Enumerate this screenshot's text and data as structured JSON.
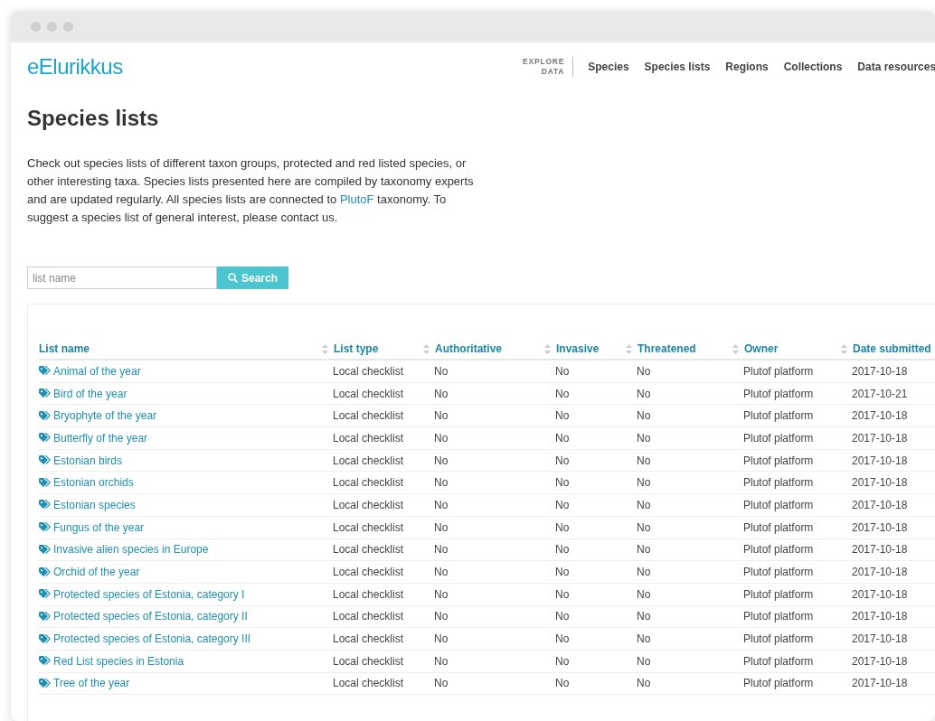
{
  "site": {
    "logo": "eElurikkus",
    "nav_caption": [
      "EXPLORE",
      "DATA"
    ],
    "nav": [
      "Species",
      "Species lists",
      "Regions",
      "Collections",
      "Data resources"
    ]
  },
  "page": {
    "title": "Species lists",
    "intro_before_link": "Check out species lists of different taxon groups, protected and red listed species, or other interesting taxa. Species lists presented here are compiled by taxonomy experts and are updated regularly. All species lists are connected to ",
    "intro_link": "PlutoF",
    "intro_after_link": " taxonomy. To suggest a species list of general interest, please contact us."
  },
  "search": {
    "placeholder": "list name",
    "button": "Search"
  },
  "table": {
    "columns": [
      "List name",
      "List type",
      "Authoritative",
      "Invasive",
      "Threatened",
      "Owner",
      "Date submitted"
    ],
    "rows": [
      [
        "Animal of the year",
        "Local checklist",
        "No",
        "No",
        "No",
        "Plutof platform",
        "2017-10-18"
      ],
      [
        "Bird of the year",
        "Local checklist",
        "No",
        "No",
        "No",
        "Plutof platform",
        "2017-10-21"
      ],
      [
        "Bryophyte of the year",
        "Local checklist",
        "No",
        "No",
        "No",
        "Plutof platform",
        "2017-10-18"
      ],
      [
        "Butterfly of the year",
        "Local checklist",
        "No",
        "No",
        "No",
        "Plutof platform",
        "2017-10-18"
      ],
      [
        "Estonian birds",
        "Local checklist",
        "No",
        "No",
        "No",
        "Plutof platform",
        "2017-10-18"
      ],
      [
        "Estonian orchids",
        "Local checklist",
        "No",
        "No",
        "No",
        "Plutof platform",
        "2017-10-18"
      ],
      [
        "Estonian species",
        "Local checklist",
        "No",
        "No",
        "No",
        "Plutof platform",
        "2017-10-18"
      ],
      [
        "Fungus of the year",
        "Local checklist",
        "No",
        "No",
        "No",
        "Plutof platform",
        "2017-10-18"
      ],
      [
        "Invasive alien species in Europe",
        "Local checklist",
        "No",
        "No",
        "No",
        "Plutof platform",
        "2017-10-18"
      ],
      [
        "Orchid of the year",
        "Local checklist",
        "No",
        "No",
        "No",
        "Plutof platform",
        "2017-10-18"
      ],
      [
        "Protected species of Estonia, category I",
        "Local checklist",
        "No",
        "No",
        "No",
        "Plutof platform",
        "2017-10-18"
      ],
      [
        "Protected species of Estonia, category II",
        "Local checklist",
        "No",
        "No",
        "No",
        "Plutof platform",
        "2017-10-18"
      ],
      [
        "Protected species of Estonia, category III",
        "Local checklist",
        "No",
        "No",
        "No",
        "Plutof platform",
        "2017-10-18"
      ],
      [
        "Red List species in Estonia",
        "Local checklist",
        "No",
        "No",
        "No",
        "Plutof platform",
        "2017-10-18"
      ],
      [
        "Tree of the year",
        "Local checklist",
        "No",
        "No",
        "No",
        "Plutof platform",
        "2017-10-18"
      ]
    ]
  }
}
